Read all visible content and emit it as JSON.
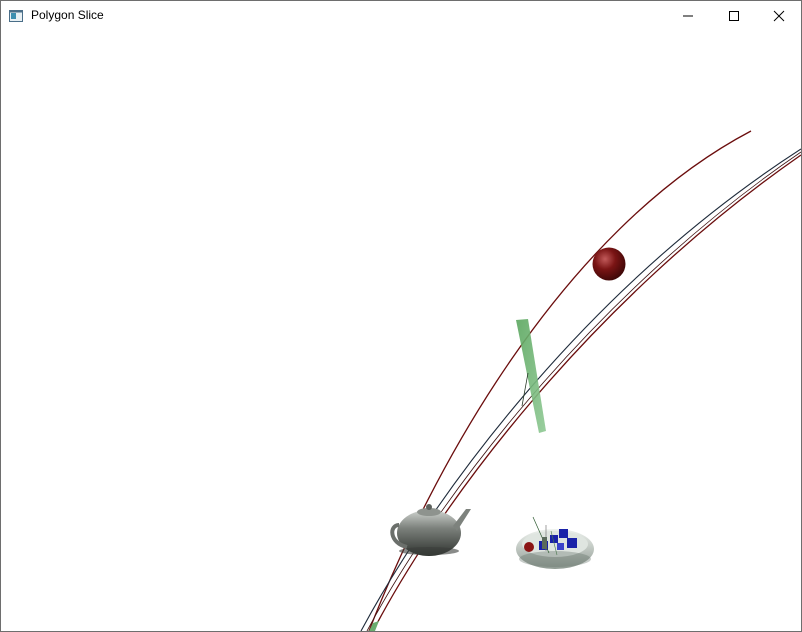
{
  "window": {
    "title": "Polygon Slice",
    "icon": "app-window-icon",
    "controls": {
      "minimize_icon": "minimize-icon",
      "maximize_icon": "maximize-icon",
      "close_icon": "close-icon"
    }
  },
  "scene": {
    "background_color": "#ffffff",
    "curve_color": "#6b0d0d",
    "curve_secondary_color": "#1e2a3a",
    "sphere_color": "#7a1414",
    "plane_color": "#6aad6e",
    "teapot_color": "#6b6f6b",
    "dish_color": "#c7d0c9",
    "cube_color": "#1a22a8"
  }
}
